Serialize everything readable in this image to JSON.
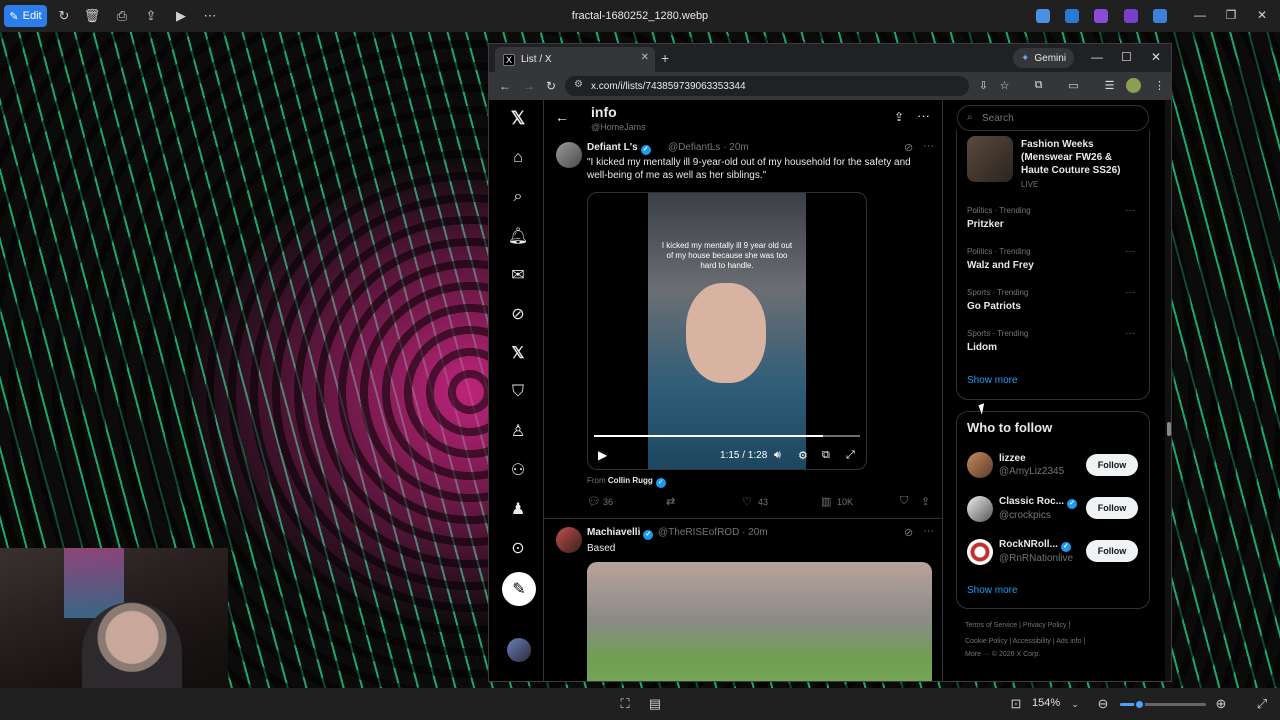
{
  "viewer": {
    "edit_label": "Edit",
    "file_title": "fractal-1680252_1280.webp",
    "zoom_level": "154%",
    "zoom_fraction": 0.22
  },
  "browser": {
    "tab_title": "List / X",
    "tab_favicon": "X",
    "gemini_label": "Gemini",
    "url": "x.com/i/lists/743859739063353344"
  },
  "list_header": {
    "title": "info",
    "handle": "@HomeJams"
  },
  "tweets": [
    {
      "name": "Defiant L's",
      "handle": "@DefiantLs · 20m",
      "text": "\"I kicked my mentally ill 9-year-old out of my household for the safety and well-being of me as well as her siblings.\"",
      "video_caption": "I kicked my mentally ill 9 year old out of my house because she was too hard to handle.",
      "video_time": "1:15 / 1:28",
      "video_progress": 0.86,
      "from_label": "From",
      "from_name": "Collin Rugg",
      "replies": "36",
      "likes": "43",
      "views": "10K"
    },
    {
      "name": "Machiavelli",
      "handle": "@TheRISEofROD · 20m",
      "text": "Based"
    }
  ],
  "sidebar": {
    "search_placeholder": "Search",
    "featured": {
      "title": "Fashion Weeks (Menswear FW26 & Haute Couture SS26)",
      "status": "LIVE"
    },
    "trends": [
      {
        "category": "Politics · Trending",
        "name": "Pritzker"
      },
      {
        "category": "Politics · Trending",
        "name": "Walz and Frey"
      },
      {
        "category": "Sports · Trending",
        "name": "Go Patriots"
      },
      {
        "category": "Sports · Trending",
        "name": "Lidom"
      }
    ],
    "show_more": "Show more",
    "who_to_follow": {
      "title": "Who to follow",
      "accounts": [
        {
          "name": "lizzee",
          "handle": "@AmyLiz2345",
          "button": "Follow"
        },
        {
          "name": "Classic Roc...",
          "handle": "@crockpics",
          "button": "Follow"
        },
        {
          "name": "RockNRoll...",
          "handle": "@RnRNationlive",
          "button": "Follow"
        }
      ],
      "show_more": "Show more"
    },
    "footer": {
      "line1": [
        "Terms of Service",
        "|",
        "Privacy Policy",
        "|"
      ],
      "line2": [
        "Cookie Policy",
        "|",
        "Accessibility",
        "|",
        "Ads info",
        "|"
      ],
      "line3": [
        "More ···",
        "© 2026 X Corp."
      ]
    }
  }
}
